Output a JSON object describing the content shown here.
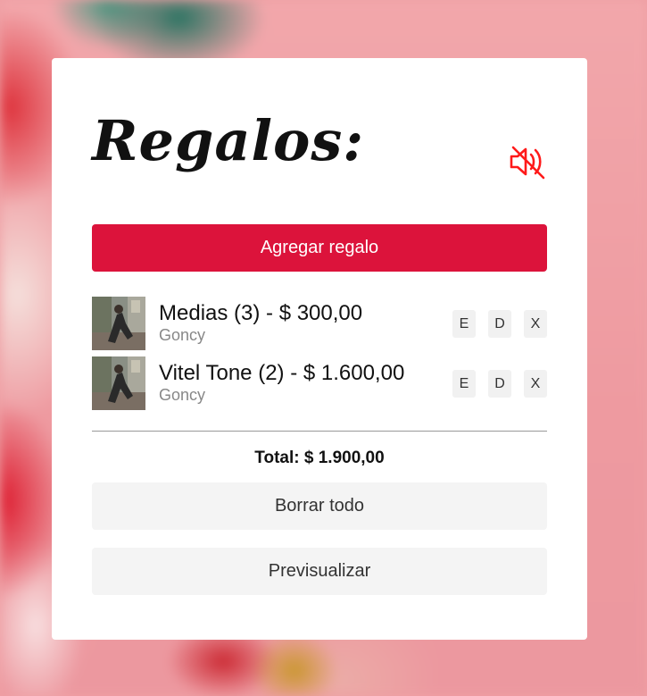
{
  "header": {
    "title": "Regalos:",
    "mute_icon": "volume-mute-icon",
    "mute_color": "#ff1a1a"
  },
  "add_button": {
    "label": "Agregar regalo",
    "color": "#dc133b"
  },
  "gifts": [
    {
      "title": "Medias (3) - $ 300,00",
      "recipient": "Goncy",
      "thumbnail": "gift-photo",
      "actions": {
        "edit": "E",
        "duplicate": "D",
        "delete": "X"
      }
    },
    {
      "title": "Vitel Tone (2) - $ 1.600,00",
      "recipient": "Goncy",
      "thumbnail": "gift-photo",
      "actions": {
        "edit": "E",
        "duplicate": "D",
        "delete": "X"
      }
    }
  ],
  "total": "Total: $ 1.900,00",
  "clear_button": {
    "label": "Borrar todo"
  },
  "preview_button": {
    "label": "Previsualizar"
  }
}
